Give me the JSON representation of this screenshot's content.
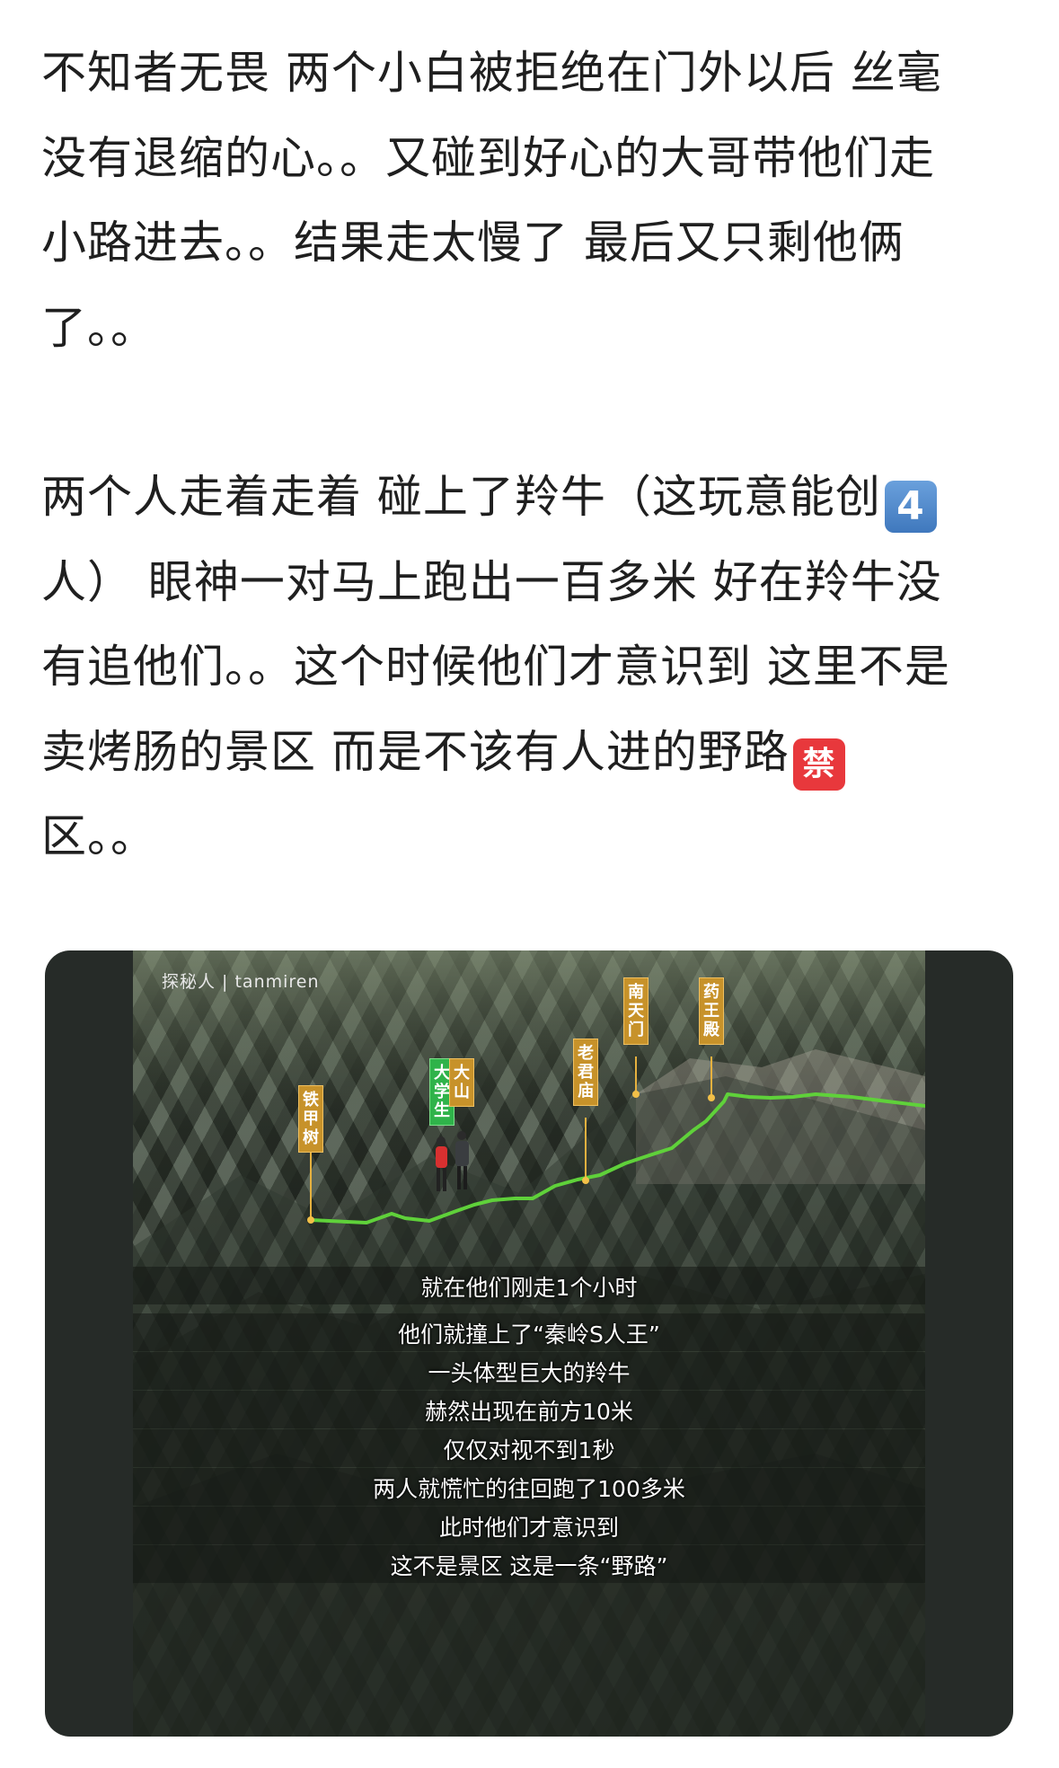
{
  "post": {
    "paragraph1": [
      "不知者无畏 两个小白被拒绝在门外以后 丝毫",
      "没有退缩的心。。又碰到好心的大哥带他们走",
      "小路进去。。结果走太慢了 最后又只剩他俩",
      "了。。"
    ],
    "paragraph2": {
      "line1_before": "两个人走着走着 碰上了羚牛（这玩意能创",
      "keycap_emoji": "4",
      "line2": "人） 眼神一对马上跑出一百多米 好在羚牛没",
      "line3": "有追他们。。这个时候他们才意识到 这里不是",
      "line4_before": "卖烤肠的景区 而是不该有人进的野路",
      "forbidden_emoji": "禁",
      "line5": "区。。"
    }
  },
  "image": {
    "watermark": "探秘人 | tanmiren",
    "markers": {
      "tiejiashu": "铁甲树",
      "daxuesheng": "大学生",
      "dashan": "大山",
      "laojunmiao": "老君庙",
      "nantianmen": "南天门",
      "yaowangdian": "药王殿"
    },
    "subtitles": [
      "就在他们刚走1个小时",
      "他们就撞上了“秦岭S人王”",
      "一头体型巨大的羚牛",
      "赫然出现在前方10米",
      "仅仅对视不到1秒",
      "两人就慌忙的往回跑了100多米",
      "此时他们才意识到",
      "这不是景区 这是一条“野路”"
    ],
    "corner_watermark": "",
    "colors": {
      "trail": "#5fd13a",
      "marker": "#c7922a",
      "student_marker": "#2fb34a"
    }
  }
}
